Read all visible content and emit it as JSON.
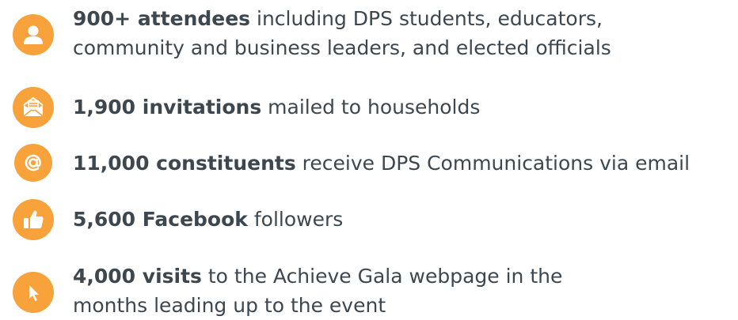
{
  "stats": [
    {
      "icon": "person-icon",
      "highlight": "900+ attendees",
      "line1_rest": " including DPS students, educators,",
      "line2": "community and business leaders, and elected officials"
    },
    {
      "icon": "envelope-icon",
      "highlight": "1,900 invitations",
      "line1_rest": " mailed to households"
    },
    {
      "icon": "at-sign-icon",
      "highlight": "11,000 constituents",
      "line1_rest": " receive DPS Communications via email"
    },
    {
      "icon": "thumbs-up-icon",
      "highlight": "5,600 Facebook",
      "line1_rest": " followers"
    },
    {
      "icon": "cursor-icon",
      "highlight": "4,000 visits",
      "line1_rest": " to the Achieve Gala webpage in the",
      "line2": "months leading up to the event"
    }
  ],
  "colors": {
    "icon_bg": "#f7a23a",
    "text": "#3d4750",
    "icon_glyph": "#ffffff"
  }
}
